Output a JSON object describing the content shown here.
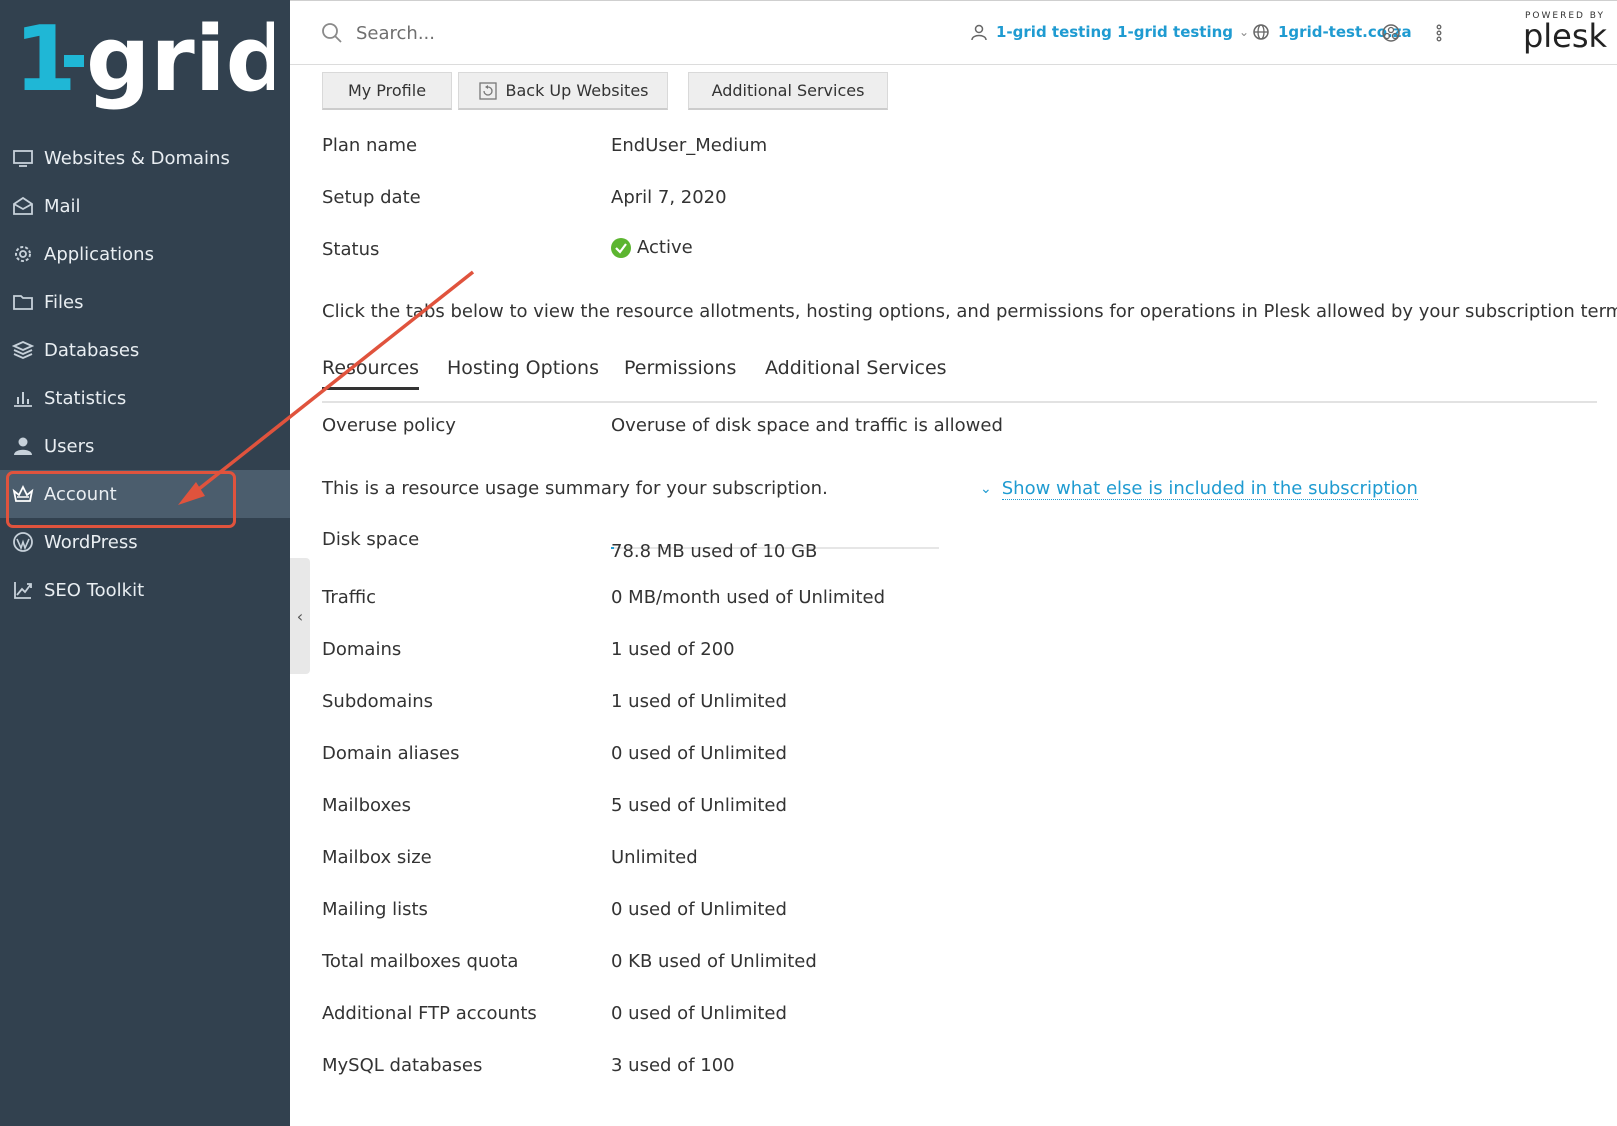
{
  "brand": {
    "logo_text": "1-grid",
    "accent": "#1fb7d6"
  },
  "sidebar": {
    "items": [
      {
        "label": "Websites & Domains",
        "icon": "monitor-icon"
      },
      {
        "label": "Mail",
        "icon": "mail-icon"
      },
      {
        "label": "Applications",
        "icon": "gear-icon"
      },
      {
        "label": "Files",
        "icon": "folder-icon"
      },
      {
        "label": "Databases",
        "icon": "database-icon"
      },
      {
        "label": "Statistics",
        "icon": "bar-chart-icon"
      },
      {
        "label": "Users",
        "icon": "user-icon"
      },
      {
        "label": "Account",
        "icon": "crown-icon",
        "active": true
      },
      {
        "label": "WordPress",
        "icon": "wordpress-icon"
      },
      {
        "label": "SEO Toolkit",
        "icon": "seo-chart-icon"
      }
    ]
  },
  "header": {
    "search_placeholder": "Search...",
    "user_label": "1-grid testing 1-grid testing",
    "domain_label": "1grid-test.co.za",
    "powered_by": "POWERED BY",
    "plesk": "plesk"
  },
  "toolbar": {
    "my_profile": "My Profile",
    "back_up": "Back Up Websites",
    "additional_services": "Additional Services"
  },
  "info": {
    "plan_name_label": "Plan name",
    "plan_name_value": "EndUser_Medium",
    "setup_date_label": "Setup date",
    "setup_date_value": "April 7, 2020",
    "status_label": "Status",
    "status_value": "Active"
  },
  "intro_text": "Click the tabs below to view the resource allotments, hosting options, and permissions for operations in Plesk allowed by your subscription terms.",
  "tabs": [
    "Resources",
    "Hosting Options",
    "Permissions",
    "Additional Services"
  ],
  "overuse": {
    "label": "Overuse policy",
    "value": "Overuse of disk space and traffic is allowed"
  },
  "summary_text": "This is a resource usage summary for your subscription.",
  "show_more": "Show what else is included in the subscription",
  "disk_usage_fraction": 0.0077,
  "resources": [
    {
      "label": "Disk space",
      "value": "78.8 MB used of 10 GB"
    },
    {
      "label": "Traffic",
      "value": "0 MB/month used of Unlimited"
    },
    {
      "label": "Domains",
      "value": "1 used of 200"
    },
    {
      "label": "Subdomains",
      "value": "1 used of Unlimited"
    },
    {
      "label": "Domain aliases",
      "value": "0 used of Unlimited"
    },
    {
      "label": "Mailboxes",
      "value": "5 used of Unlimited"
    },
    {
      "label": "Mailbox size",
      "value": "Unlimited"
    },
    {
      "label": "Mailing lists",
      "value": "0 used of Unlimited"
    },
    {
      "label": "Total mailboxes quota",
      "value": "0 KB used of Unlimited"
    },
    {
      "label": "Additional FTP accounts",
      "value": "0 used of Unlimited"
    },
    {
      "label": "MySQL databases",
      "value": "3 used of 100"
    }
  ],
  "colors": {
    "sidebar": "#32414f",
    "link": "#1f9bd1",
    "annotation": "#e0533d",
    "active_status": "#5cb530"
  }
}
